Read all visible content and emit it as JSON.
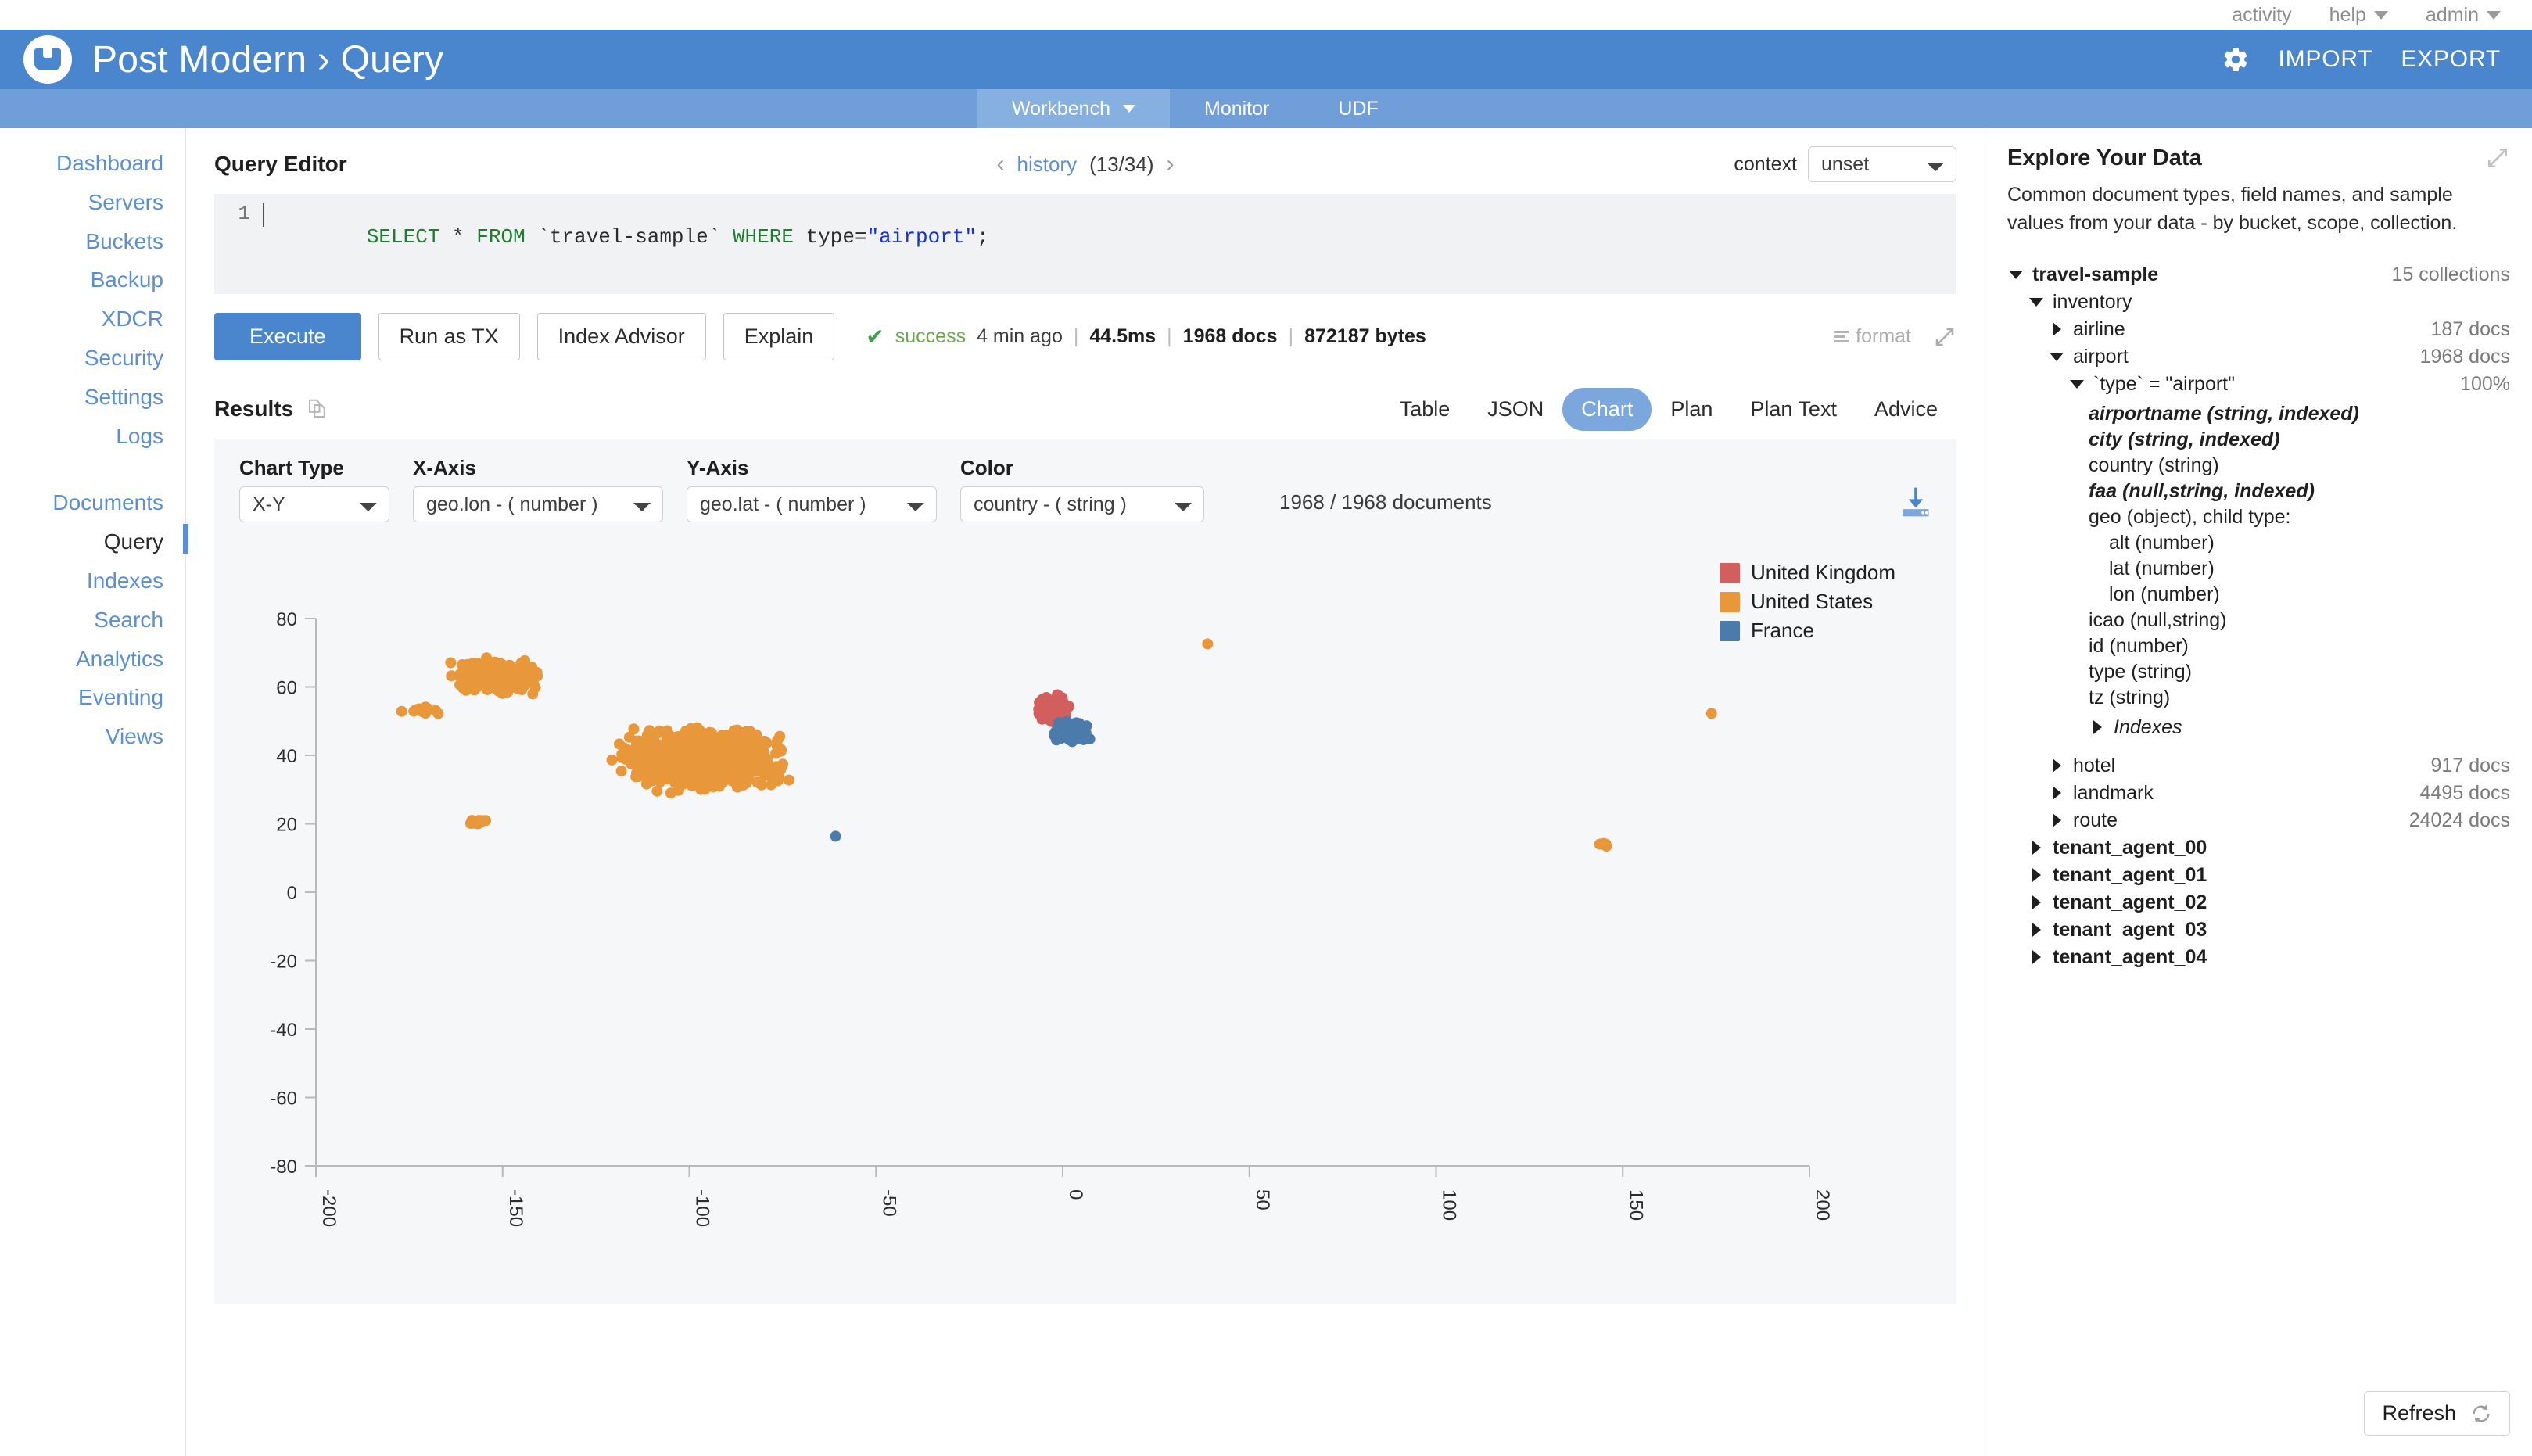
{
  "utility_bar": {
    "items": [
      {
        "label": "activity",
        "has_caret": false
      },
      {
        "label": "help",
        "has_caret": true
      },
      {
        "label": "admin",
        "has_caret": true
      }
    ]
  },
  "header": {
    "title": "Post Modern › Query",
    "gear_icon": "gear-icon",
    "import_label": "IMPORT",
    "export_label": "EXPORT",
    "brand_color": "#4a86cd"
  },
  "subnav": {
    "tabs": [
      {
        "label": "Workbench",
        "active": true,
        "has_caret": true
      },
      {
        "label": "Monitor",
        "active": false,
        "has_caret": false
      },
      {
        "label": "UDF",
        "active": false,
        "has_caret": false
      }
    ]
  },
  "sidebar": {
    "group1": [
      {
        "label": "Dashboard"
      },
      {
        "label": "Servers"
      },
      {
        "label": "Buckets"
      },
      {
        "label": "Backup"
      },
      {
        "label": "XDCR"
      },
      {
        "label": "Security"
      },
      {
        "label": "Settings"
      },
      {
        "label": "Logs"
      }
    ],
    "group2": [
      {
        "label": "Documents",
        "active": false
      },
      {
        "label": "Query",
        "active": true
      },
      {
        "label": "Indexes",
        "active": false
      },
      {
        "label": "Search",
        "active": false
      },
      {
        "label": "Analytics",
        "active": false
      },
      {
        "label": "Eventing",
        "active": false
      },
      {
        "label": "Views",
        "active": false
      }
    ]
  },
  "query_editor": {
    "title": "Query Editor",
    "history": {
      "prev_icon": "‹",
      "link_label": "history",
      "count_label": "(13/34)",
      "next_icon": "›"
    },
    "context": {
      "label": "context",
      "value": "unset",
      "options": [
        "unset"
      ]
    },
    "code": {
      "line_number": "1",
      "tokens": [
        {
          "text": "SELECT",
          "type": "kw"
        },
        {
          "text": " * ",
          "type": "plain"
        },
        {
          "text": "FROM",
          "type": "kw"
        },
        {
          "text": " `travel-sample` ",
          "type": "plain"
        },
        {
          "text": "WHERE",
          "type": "kw"
        },
        {
          "text": " type=",
          "type": "plain"
        },
        {
          "text": "\"airport\"",
          "type": "str"
        },
        {
          "text": ";",
          "type": "plain"
        }
      ]
    },
    "buttons": {
      "execute": "Execute",
      "run_as_tx": "Run as TX",
      "index_advisor": "Index Advisor",
      "explain": "Explain"
    },
    "status": {
      "check": "✔",
      "state": "success",
      "time_ago": "4 min ago",
      "separator": "|",
      "duration": "44.5ms",
      "docs": "1968 docs",
      "bytes": "872187 bytes"
    },
    "tools": {
      "format_label": "format",
      "expand_icon": "expand-icon"
    }
  },
  "results": {
    "title": "Results",
    "copy_icon": "copy-icon",
    "tabs": [
      {
        "label": "Table",
        "active": false
      },
      {
        "label": "JSON",
        "active": false
      },
      {
        "label": "Chart",
        "active": true
      },
      {
        "label": "Plan",
        "active": false
      },
      {
        "label": "Plan Text",
        "active": false
      },
      {
        "label": "Advice",
        "active": false
      }
    ]
  },
  "chart_controls": {
    "chart_type": {
      "label": "Chart Type",
      "value": "X-Y",
      "options": [
        "X-Y"
      ]
    },
    "x_axis": {
      "label": "X-Axis",
      "value": "geo.lon - ( number )",
      "options": [
        "geo.lon - ( number )"
      ]
    },
    "y_axis": {
      "label": "Y-Axis",
      "value": "geo.lat - ( number )",
      "options": [
        "geo.lat - ( number )"
      ]
    },
    "color": {
      "label": "Color",
      "value": "country - ( string )",
      "options": [
        "country - ( string )"
      ]
    },
    "doc_count": "1968 / 1968 documents",
    "download_icon": "download-icon"
  },
  "chart_data": {
    "type": "scatter",
    "title": "",
    "xlabel": "geo.lon - ( number )",
    "ylabel": "geo.lat - ( number )",
    "xlim": [
      -200,
      200
    ],
    "ylim": [
      -80,
      80
    ],
    "xticks": [
      -200,
      -150,
      -100,
      -50,
      0,
      50,
      100,
      150,
      200
    ],
    "yticks": [
      80,
      60,
      40,
      20,
      0,
      -20,
      -40,
      -60,
      -80
    ],
    "grid": false,
    "legend_position": "top-right",
    "total_points": 1968,
    "series": [
      {
        "name": "United Kingdom",
        "color": "#d35e5e",
        "approx_count": 180,
        "note": "Tight cluster over the British Isles",
        "cluster": {
          "cx": -2.5,
          "cy": 53.5,
          "rx": 5.5,
          "ry": 5.0,
          "n": 180
        }
      },
      {
        "name": "United States",
        "color": "#e8973a",
        "approx_count": 1580,
        "note": "Continental US outline plus Alaska, Hawaii and Pacific/Caribbean outliers",
        "clusters": [
          {
            "name": "continental-us",
            "cx": -96,
            "cy": 39,
            "rx": 26,
            "ry": 11,
            "n": 1150
          },
          {
            "name": "alaska",
            "cx": -152,
            "cy": 63,
            "rx": 14,
            "ry": 6,
            "n": 300
          },
          {
            "name": "aleutians",
            "cx": -172,
            "cy": 53,
            "rx": 6,
            "ry": 2,
            "n": 18
          },
          {
            "name": "hawaii",
            "cx": -157,
            "cy": 20.5,
            "rx": 3,
            "ry": 1.2,
            "n": 14
          },
          {
            "name": "guam-pacific",
            "cx": 145,
            "cy": 14,
            "rx": 4,
            "ry": 2,
            "n": 6
          },
          {
            "name": "atlantic-outlier",
            "cx": 174,
            "cy": 52,
            "rx": 1,
            "ry": 1,
            "n": 1
          },
          {
            "name": "north-outlier",
            "cx": 39,
            "cy": 72,
            "rx": 1,
            "ry": 1,
            "n": 1
          }
        ]
      },
      {
        "name": "France",
        "color": "#4a7bab",
        "approx_count": 208,
        "note": "Cluster over France with overseas points",
        "clusters": [
          {
            "name": "metropolitan-france",
            "cx": 2.5,
            "cy": 47,
            "rx": 5.5,
            "ry": 3.5,
            "n": 195
          },
          {
            "name": "caribbean-reunion",
            "cx": -61,
            "cy": 16,
            "rx": 1,
            "ry": 1,
            "n": 1
          },
          {
            "name": "pacific",
            "cx": 8,
            "cy": 45,
            "rx": 1,
            "ry": 1,
            "n": 1
          }
        ]
      }
    ],
    "legend": [
      {
        "label": "United Kingdom",
        "color": "#d35e5e"
      },
      {
        "label": "United States",
        "color": "#e8973a"
      },
      {
        "label": "France",
        "color": "#4a7bab"
      }
    ]
  },
  "explore_panel": {
    "title": "Explore Your Data",
    "expand_icon": "expand-icon",
    "description": "Common document types, field names, and sample values from your data - by bucket, scope, collection.",
    "tree": [
      {
        "label": "travel-sample",
        "meta": "15 collections",
        "indent": 0,
        "toggle": "down",
        "bold": true
      },
      {
        "label": "inventory",
        "meta": "",
        "indent": 1,
        "toggle": "down",
        "bold": false
      },
      {
        "label": "airline",
        "meta": "187 docs",
        "indent": 2,
        "toggle": "right",
        "bold": false
      },
      {
        "label": "airport",
        "meta": "1968 docs",
        "indent": 2,
        "toggle": "down",
        "bold": false
      },
      {
        "label": "`type` = \"airport\"",
        "meta": "100%",
        "indent": 3,
        "toggle": "down",
        "bold": false
      }
    ],
    "fields": [
      {
        "text": "airportname (string, indexed)",
        "indexed": true,
        "indent": 0
      },
      {
        "text": "city (string, indexed)",
        "indexed": true,
        "indent": 0
      },
      {
        "text": "country (string)",
        "indexed": false,
        "indent": 0
      },
      {
        "text": "faa (null,string, indexed)",
        "indexed": true,
        "indent": 0
      },
      {
        "text": "geo (object), child type:",
        "indexed": false,
        "indent": 0
      },
      {
        "text": "alt (number)",
        "indexed": false,
        "indent": 1
      },
      {
        "text": "lat (number)",
        "indexed": false,
        "indent": 1
      },
      {
        "text": "lon (number)",
        "indexed": false,
        "indent": 1
      },
      {
        "text": "icao (null,string)",
        "indexed": false,
        "indent": 0
      },
      {
        "text": "id (number)",
        "indexed": false,
        "indent": 0
      },
      {
        "text": "type (string)",
        "indexed": false,
        "indent": 0
      },
      {
        "text": "tz (string)",
        "indexed": false,
        "indent": 0
      }
    ],
    "indexes_label": "Indexes",
    "tree_tail": [
      {
        "label": "hotel",
        "meta": "917 docs",
        "indent": 2,
        "toggle": "right",
        "bold": false
      },
      {
        "label": "landmark",
        "meta": "4495 docs",
        "indent": 2,
        "toggle": "right",
        "bold": false
      },
      {
        "label": "route",
        "meta": "24024 docs",
        "indent": 2,
        "toggle": "right",
        "bold": false
      },
      {
        "label": "tenant_agent_00",
        "meta": "",
        "indent": 1,
        "toggle": "right",
        "bold": true
      },
      {
        "label": "tenant_agent_01",
        "meta": "",
        "indent": 1,
        "toggle": "right",
        "bold": true
      },
      {
        "label": "tenant_agent_02",
        "meta": "",
        "indent": 1,
        "toggle": "right",
        "bold": true
      },
      {
        "label": "tenant_agent_03",
        "meta": "",
        "indent": 1,
        "toggle": "right",
        "bold": true
      },
      {
        "label": "tenant_agent_04",
        "meta": "",
        "indent": 1,
        "toggle": "right",
        "bold": true
      }
    ],
    "refresh": {
      "label": "Refresh",
      "icon": "refresh-icon"
    }
  }
}
